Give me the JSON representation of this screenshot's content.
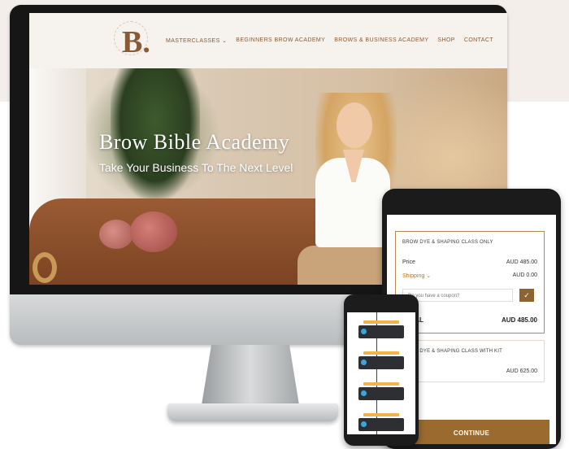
{
  "site": {
    "logo_letter": "B.",
    "nav": [
      "MASTERCLASSES ⌄",
      "BEGINNERS BROW ACADEMY",
      "BROWS & BUSINESS ACADEMY",
      "SHOP",
      "CONTACT"
    ],
    "hero_title": "Brow Bible Academy",
    "hero_subtitle": "Take Your Business To The Next Level"
  },
  "checkout": {
    "product_1": {
      "title": "BROW DYE & SHAPING CLASS ONLY",
      "price_label": "Price",
      "price_value": "AUD 485.00",
      "shipping_label": "Shipping ⌄",
      "shipping_value": "AUD 0.00",
      "coupon_placeholder": "Do you have a coupon?",
      "coupon_button_icon": "check-icon",
      "total_label": "TOTAL",
      "total_value": "AUD 485.00"
    },
    "product_2": {
      "title": "BROW DYE & SHAPING CLASS WITH KIT",
      "price_value": "AUD 625.00"
    },
    "continue_label": "CONTINUE"
  },
  "colors": {
    "brand_brown": "#8a5a34",
    "button_brown": "#9a6a2f",
    "flow_node": "#2d2f33",
    "flow_accent": "#3ea6d6"
  }
}
